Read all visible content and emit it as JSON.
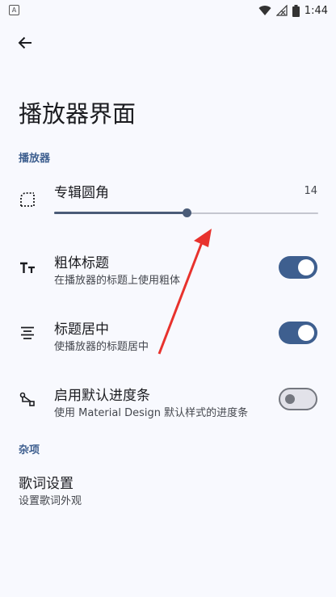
{
  "status_bar": {
    "time": "1:44",
    "app_badge": "A"
  },
  "page": {
    "title": "播放器界面"
  },
  "sections": {
    "player": "播放器",
    "misc": "杂项"
  },
  "album_corner": {
    "title": "专辑圆角",
    "value": "14",
    "slider_fraction": 0.5
  },
  "bold_title": {
    "title": "粗体标题",
    "summary": "在播放器的标题上使用粗体",
    "enabled": true
  },
  "center_title": {
    "title": "标题居中",
    "summary": "使播放器的标题居中",
    "enabled": true
  },
  "default_progress": {
    "title": "启用默认进度条",
    "summary": "使用 Material Design 默认样式的进度条",
    "enabled": false
  },
  "lyrics": {
    "title": "歌词设置",
    "summary": "设置歌词外观"
  },
  "colors": {
    "accent": "#3e5f8f",
    "background": "#f8f9fe",
    "annotation_arrow": "#e8322d"
  }
}
